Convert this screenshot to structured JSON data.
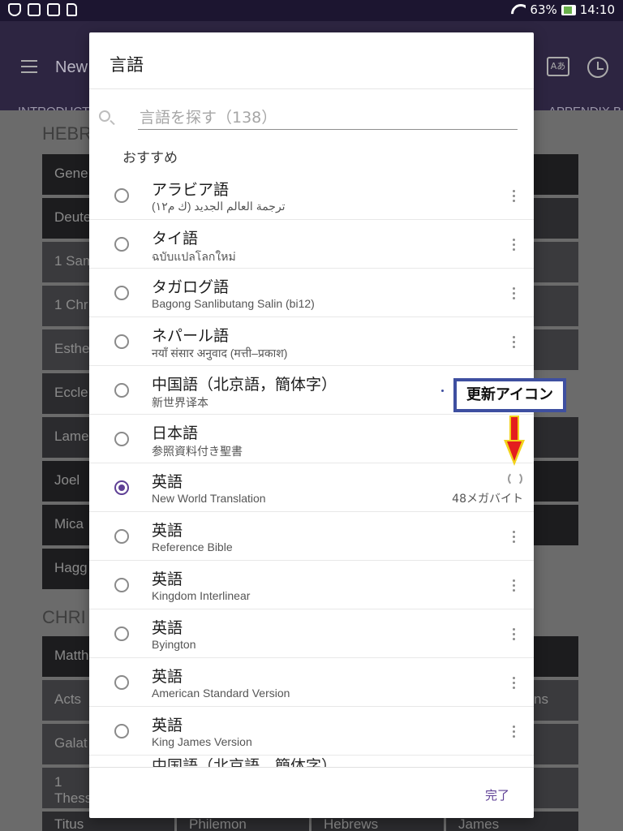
{
  "statusbar": {
    "battery": "63%",
    "time": "14:10"
  },
  "app": {
    "title": "New",
    "tabs": {
      "left": "INTRODUCT",
      "right": "APPENDIX B"
    },
    "sections": {
      "hebrew": "HEBR",
      "christian": "CHRI"
    },
    "books": [
      "Gene",
      "Deute",
      "1 Sam",
      "1 Chr",
      "Esthe",
      "Eccle",
      "Lame",
      "Joel",
      "Mica",
      "Hagg",
      "Matth",
      "Acts",
      "Galat",
      "1\nThess"
    ],
    "books_right": [
      "ns"
    ],
    "bottom_row": [
      "Titus",
      "Philemon",
      "Hebrews",
      "James"
    ]
  },
  "dialog": {
    "title": "言語",
    "search_placeholder": "言語を探す（138）",
    "section_label": "おすすめ",
    "languages": [
      {
        "name": "アラビア語",
        "sub": "ترجمة العالم الجديد (ك م١٢)",
        "selected": false
      },
      {
        "name": "タイ語",
        "sub": "ฉบับแปลโลกใหม่",
        "selected": false
      },
      {
        "name": "タガログ語",
        "sub": "Bagong Sanlibutang Salin (bi12)",
        "selected": false
      },
      {
        "name": "ネパール語",
        "sub": "नयाँ संसार अनुवाद (मत्ती–प्रकाश)",
        "selected": false
      },
      {
        "name": "中国語（北京語，簡体字）",
        "sub": "新世界译本",
        "selected": false
      },
      {
        "name": "日本語",
        "sub": "参照資料付き聖書",
        "selected": false
      },
      {
        "name": "英語",
        "sub": "New World Translation",
        "selected": true,
        "size": "48メガバイト"
      },
      {
        "name": "英語",
        "sub": "Reference Bible",
        "selected": false
      },
      {
        "name": "英語",
        "sub": "Kingdom Interlinear",
        "selected": false
      },
      {
        "name": "英語",
        "sub": "Byington",
        "selected": false
      },
      {
        "name": "英語",
        "sub": "American Standard Version",
        "selected": false
      },
      {
        "name": "英語",
        "sub": "King James Version",
        "selected": false
      }
    ],
    "partial_item": "中国語（北京語，簡体字）",
    "done_label": "完了"
  },
  "annotation": {
    "callout_text": "更新アイコン"
  },
  "colors": {
    "accent": "#5e3f95",
    "appbar": "#2d2541",
    "callout_border": "#3e4fa0",
    "arrow_red": "#e41e1e",
    "arrow_yellow": "#f2d21b"
  }
}
